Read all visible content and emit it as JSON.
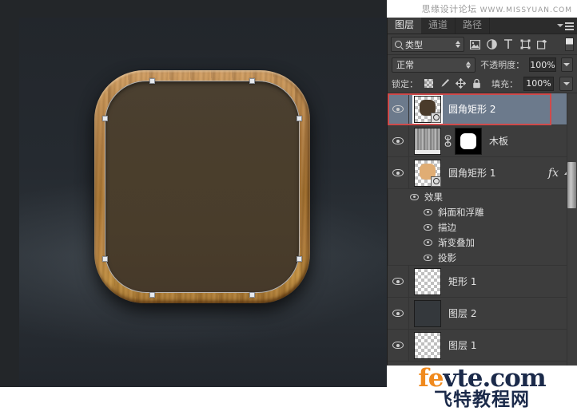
{
  "watermark_top": {
    "cn": "思缘设计论坛",
    "en": "WWW.MISSYUAN.COM"
  },
  "watermark_bottom": {
    "en_orange": "fe",
    "en_dark": "vte.com",
    "cn": "飞特教程网"
  },
  "colors": {
    "panel_bg": "#3d3d3d",
    "selected_row": "#6c7a8c",
    "annotation_red": "#d04a4a",
    "wood_light": "#d7a469",
    "wood_dark": "#a8742f",
    "inner_brown": "#4b4031"
  },
  "canvas": {
    "artwork_name": "wooden-rounded-icon",
    "anchor_point_count": 8
  },
  "panel": {
    "tabs": [
      {
        "label": "图层",
        "active": true
      },
      {
        "label": "通道",
        "active": false
      },
      {
        "label": "路径",
        "active": false
      }
    ],
    "menu_icon": "panel-menu-icon",
    "filter": {
      "search_icon": "search-icon",
      "kind_value": "类型",
      "icons": [
        {
          "name": "pixel-layers-filter-icon",
          "glyph": "▣"
        },
        {
          "name": "adjustment-layers-filter-icon",
          "glyph": "◕"
        },
        {
          "name": "type-layers-filter-icon",
          "glyph": "T"
        },
        {
          "name": "shape-layers-filter-icon",
          "glyph": "⛶"
        },
        {
          "name": "smart-object-filter-icon",
          "glyph": "◳"
        }
      ],
      "toggle_name": "filter-enable-toggle"
    },
    "blend": {
      "mode": "正常",
      "opacity_label": "不透明度：",
      "opacity_value": "100%"
    },
    "lock": {
      "label": "锁定：",
      "icons": [
        {
          "name": "lock-transparent-pixels-icon"
        },
        {
          "name": "lock-image-pixels-icon",
          "glyph": "✎"
        },
        {
          "name": "lock-position-icon",
          "glyph": "✛"
        },
        {
          "name": "lock-all-icon",
          "glyph": "🔒"
        }
      ],
      "fill_label": "填充：",
      "fill_value": "100%"
    },
    "layers": [
      {
        "name": "圆角矩形 2",
        "selected": true,
        "visible": true,
        "thumb_type": "vector-brown",
        "has_fx": false,
        "has_mask": false,
        "annotated": true
      },
      {
        "name": "木板",
        "selected": false,
        "visible": true,
        "thumb_type": "wood-grayscale",
        "has_fx": false,
        "has_mask": true,
        "link_icon": "mask-link-icon"
      },
      {
        "name": "圆角矩形 1",
        "selected": false,
        "visible": true,
        "thumb_type": "vector-tan",
        "has_fx": true,
        "fx_glyph": "fx",
        "has_mask": false,
        "expanded": true
      }
    ],
    "effects": {
      "group_label": "效果",
      "items": [
        "斜面和浮雕",
        "描边",
        "渐变叠加",
        "投影"
      ]
    },
    "layers_bottom": [
      {
        "name": "矩形 1",
        "visible": true,
        "thumb_type": "empty"
      },
      {
        "name": "图层 2",
        "visible": true,
        "thumb_type": "solid-dark"
      },
      {
        "name": "图层 1",
        "visible": true,
        "thumb_type": "empty"
      }
    ],
    "scrollbar": "layers-vertical-scrollbar"
  }
}
